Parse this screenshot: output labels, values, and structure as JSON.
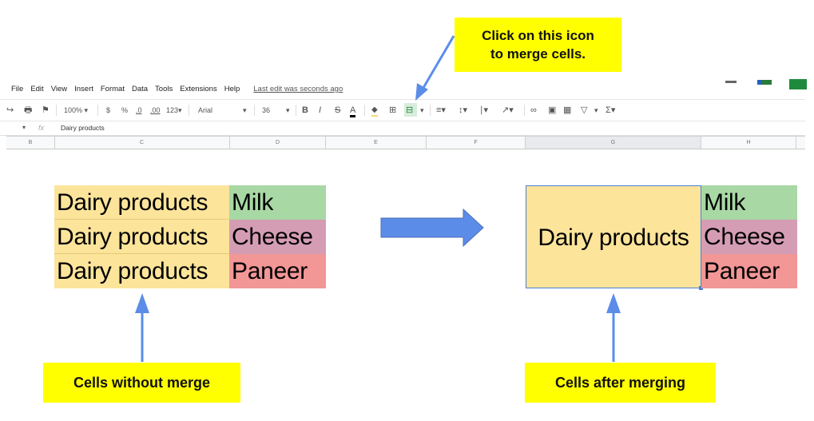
{
  "menu": {
    "items": [
      "File",
      "Edit",
      "View",
      "Insert",
      "Format",
      "Data",
      "Tools",
      "Extensions",
      "Help"
    ],
    "last_edit": "Last edit was seconds ago"
  },
  "toolbar": {
    "undo_icon": "undo-icon",
    "print_icon": "print-icon",
    "paint_format_icon": "paint-format-icon",
    "zoom": "100%",
    "currency": "$",
    "percent": "%",
    "decrease_decimal": ".0",
    "increase_decimal": ".00",
    "more_formats": "123",
    "font": "Arial",
    "font_size": "36",
    "bold": "B",
    "italic": "I",
    "strikethrough": "S",
    "text_color": "A",
    "sum": "Σ"
  },
  "formula_bar": {
    "fx": "fx",
    "value": "Dairy products"
  },
  "columns": [
    "B",
    "C",
    "D",
    "E",
    "F",
    "G",
    "H"
  ],
  "before_table": {
    "rows": [
      {
        "category": "Dairy products",
        "item": "Milk"
      },
      {
        "category": "Dairy products",
        "item": "Cheese"
      },
      {
        "category": "Dairy products",
        "item": "Paneer"
      }
    ]
  },
  "after_table": {
    "merged_category": "Dairy products",
    "items": [
      "Milk",
      "Cheese",
      "Paneer"
    ]
  },
  "callouts": {
    "top_line1": "Click on this icon",
    "top_line2": "to merge cells.",
    "left": "Cells without merge",
    "right": "Cells after merging"
  },
  "colors": {
    "callout": "#ffff00",
    "arrow": "#5b8de8",
    "yellow_cell": "#fce49a",
    "green_cell": "#a8d8a4",
    "purple_cell": "#d59db3",
    "red_cell": "#f29696",
    "selection": "#4a7fd8"
  }
}
